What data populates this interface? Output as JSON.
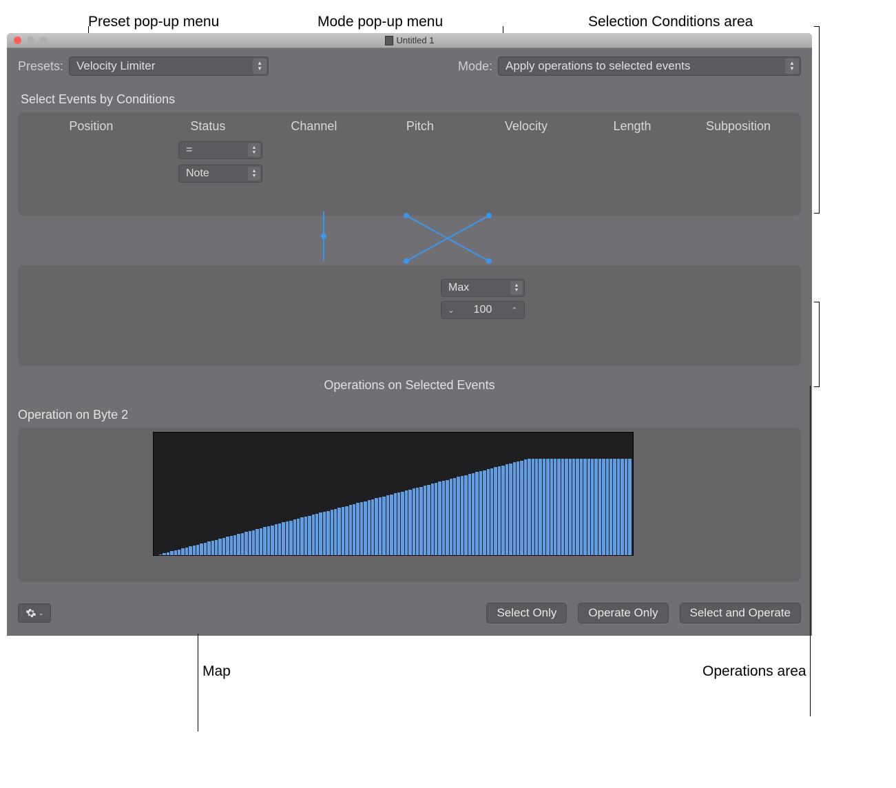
{
  "callouts": {
    "preset": "Preset pop-up menu",
    "mode": "Mode pop-up menu",
    "selection": "Selection Conditions area",
    "map": "Map",
    "ops": "Operations area"
  },
  "window": {
    "title": "Untitled 1"
  },
  "toolbar": {
    "presets_label": "Presets:",
    "presets_value": "Velocity Limiter",
    "mode_label": "Mode:",
    "mode_value": "Apply operations to selected events"
  },
  "conditions": {
    "title": "Select Events by Conditions",
    "headers": {
      "position": "Position",
      "status": "Status",
      "channel": "Channel",
      "pitch": "Pitch",
      "velocity": "Velocity",
      "length": "Length",
      "subposition": "Subposition"
    },
    "status_op": "=",
    "status_val": "Note"
  },
  "operations": {
    "mid_label": "Operations on Selected Events",
    "op_select": "Max",
    "op_value": "100",
    "byte2_label": "Operation on Byte 2"
  },
  "chart_data": {
    "type": "bar",
    "categories_count": 128,
    "limit": 100,
    "max": 127,
    "xlabel": "",
    "ylabel": "",
    "title": ""
  },
  "buttons": {
    "select_only": "Select Only",
    "operate_only": "Operate Only",
    "select_and_operate": "Select and Operate"
  }
}
